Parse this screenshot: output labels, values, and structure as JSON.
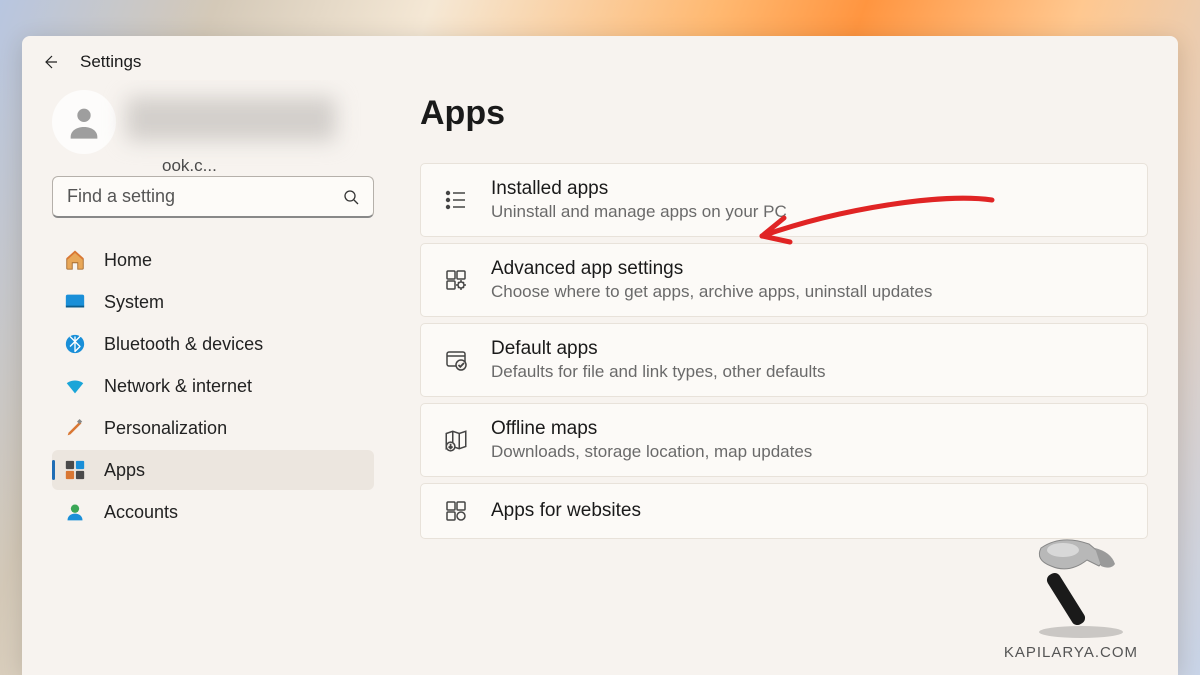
{
  "titlebar": {
    "title": "Settings"
  },
  "profile": {
    "email_fragment": "ook.c..."
  },
  "search": {
    "placeholder": "Find a setting"
  },
  "sidebar": {
    "items": [
      {
        "label": "Home"
      },
      {
        "label": "System"
      },
      {
        "label": "Bluetooth & devices"
      },
      {
        "label": "Network & internet"
      },
      {
        "label": "Personalization"
      },
      {
        "label": "Apps"
      },
      {
        "label": "Accounts"
      }
    ]
  },
  "main": {
    "title": "Apps",
    "options": [
      {
        "title": "Installed apps",
        "desc": "Uninstall and manage apps on your PC"
      },
      {
        "title": "Advanced app settings",
        "desc": "Choose where to get apps, archive apps, uninstall updates"
      },
      {
        "title": "Default apps",
        "desc": "Defaults for file and link types, other defaults"
      },
      {
        "title": "Offline maps",
        "desc": "Downloads, storage location, map updates"
      },
      {
        "title": "Apps for websites",
        "desc": ""
      }
    ]
  },
  "watermark": {
    "text": "KAPILARYA.COM"
  }
}
